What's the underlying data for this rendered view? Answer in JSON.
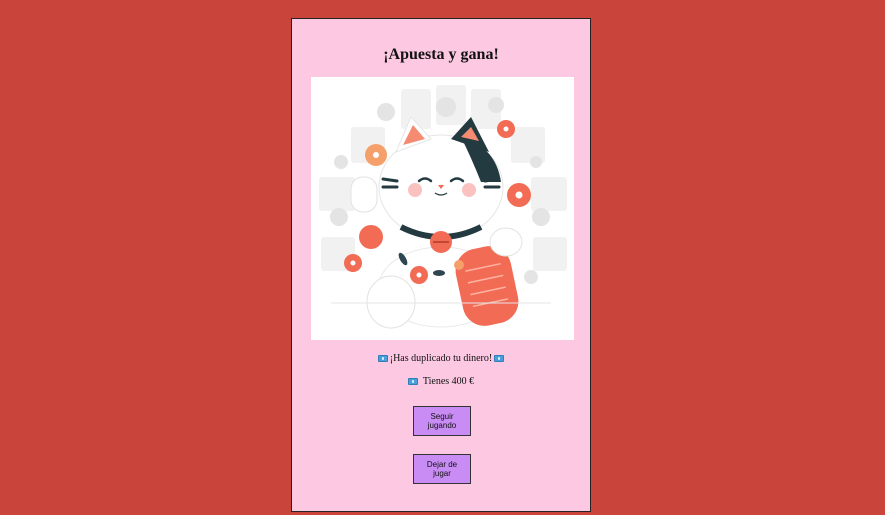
{
  "card": {
    "title": "¡Apuesta y gana!",
    "image": {
      "description_icon": "lucky-cat-illustration-icon"
    },
    "message": "¡Has duplicado tu dinero!",
    "balance": "Tienes 400 €",
    "buttons": {
      "continue": "Seguir jugando",
      "quit": "Dejar de jugar"
    }
  },
  "colors": {
    "page_background": "#c9443a",
    "card_background": "#fcc8e2",
    "button_background": "#c98cf5",
    "money_icon": "#4a9fd8"
  }
}
